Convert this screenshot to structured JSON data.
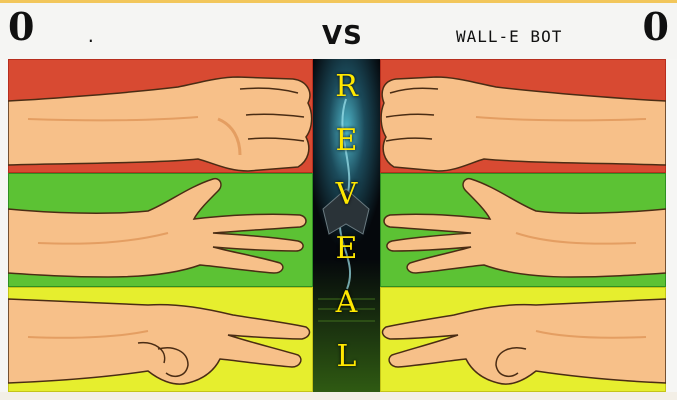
{
  "scoreboard": {
    "player_score": "0",
    "player_name": ".",
    "vs_label": "VS",
    "opponent_name": "WALL-E BOT",
    "opponent_score": "0"
  },
  "reveal": {
    "letters": [
      "R",
      "E",
      "V",
      "E",
      "A",
      "L"
    ]
  },
  "lanes": [
    {
      "name": "rock",
      "color": "#d84a32",
      "border": "#b72e1e"
    },
    {
      "name": "paper",
      "color": "#5cc234",
      "border": "#2f8f22"
    },
    {
      "name": "scissors",
      "color": "#e6ee2e",
      "border": "#c4c418"
    }
  ],
  "colors": {
    "skin": "#f7c089",
    "skin_shade": "#e49e62",
    "outline": "#4a2c14",
    "reveal_text": "#ffe800"
  }
}
